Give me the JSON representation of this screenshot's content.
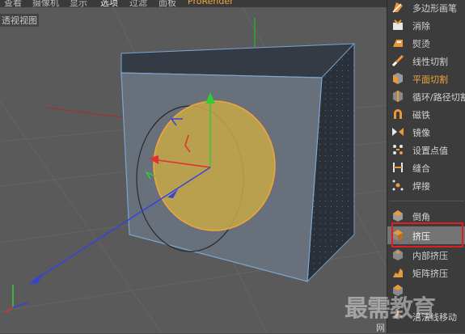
{
  "menu": {
    "items": [
      "查看",
      "摄像机",
      "显示",
      "选项",
      "过滤",
      "面板",
      "ProRender"
    ],
    "active_item": "选项"
  },
  "viewport": {
    "label": "透视视图"
  },
  "tools": [
    {
      "label": "多边形画笔",
      "icon": "polygon-pen-icon"
    },
    {
      "label": "消除",
      "icon": "dissolve-icon"
    },
    {
      "label": "熨烫",
      "icon": "iron-icon"
    },
    {
      "label": "线性切割",
      "icon": "line-cut-icon"
    },
    {
      "label": "平面切割",
      "icon": "plane-cut-icon"
    },
    {
      "label": "循环/路径切割",
      "icon": "loop-cut-icon"
    },
    {
      "label": "磁铁",
      "icon": "magnet-icon"
    },
    {
      "label": "镜像",
      "icon": "mirror-icon"
    },
    {
      "label": "设置点值",
      "icon": "set-point-value-icon"
    },
    {
      "label": "缝合",
      "icon": "stitch-icon"
    },
    {
      "label": "焊接",
      "icon": "weld-icon"
    },
    {
      "label": "倒角",
      "icon": "bevel-icon"
    },
    {
      "label": "挤压",
      "icon": "extrude-icon"
    },
    {
      "label": "内部挤压",
      "icon": "extrude-inner-icon"
    },
    {
      "label": "矩阵挤压",
      "icon": "matrix-extrude-icon"
    },
    {
      "label": "",
      "icon": "smooth-shift-icon"
    },
    {
      "label": "沿法线移动",
      "icon": "normal-move-icon"
    }
  ],
  "active_tool": "平面切割",
  "selected_tool": "挤压",
  "status": {
    "text": "网"
  },
  "watermark": "最需教育",
  "colors": {
    "highlight_border": "#e02020",
    "active_tool_text": "#f2a53a",
    "selection_disc": "#c8a848",
    "axis_y": "#33cc33",
    "axis_x": "#e03030",
    "axis_z": "#3344dd"
  }
}
